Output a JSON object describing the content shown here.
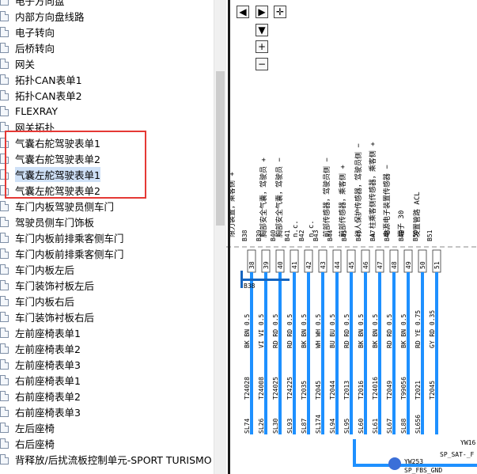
{
  "tree": {
    "items": [
      {
        "label": "电子方向盘"
      },
      {
        "label": "内部方向盘线路"
      },
      {
        "label": "电子转向"
      },
      {
        "label": "后桥转向"
      },
      {
        "label": "网关"
      },
      {
        "label": "拓扑CAN表单1"
      },
      {
        "label": "拓扑CAN表单2"
      },
      {
        "label": "FLEXRAY"
      },
      {
        "label": "网关拓扑"
      },
      {
        "label": "气囊右舵驾驶表单1"
      },
      {
        "label": "气囊右舵驾驶表单2"
      },
      {
        "label": "气囊左舵驾驶表单1",
        "selected": true
      },
      {
        "label": "气囊左舵驾驶表单2"
      },
      {
        "label": "车门内板驾驶员侧车门"
      },
      {
        "label": "驾驶员侧车门饰板"
      },
      {
        "label": "车门内板前排乘客侧车门"
      },
      {
        "label": "车门内板前排乘客侧车门"
      },
      {
        "label": "车门内板左后"
      },
      {
        "label": "车门装饰衬板左后"
      },
      {
        "label": "车门内板右后"
      },
      {
        "label": "车门装饰衬板右后"
      },
      {
        "label": "左前座椅表单1"
      },
      {
        "label": "左前座椅表单2"
      },
      {
        "label": "左前座椅表单3"
      },
      {
        "label": "右前座椅表单1"
      },
      {
        "label": "右前座椅表单2"
      },
      {
        "label": "右前座椅表单3"
      },
      {
        "label": "左后座椅"
      },
      {
        "label": "右后座椅"
      },
      {
        "label": "背释放/后扰流板控制单元-SPORT TURISMO"
      }
    ]
  },
  "toolbar": {
    "left": "◀",
    "right": "▶",
    "center": "✛",
    "up": "▲",
    "down": "▼",
    "zoom_in": "+",
    "zoom_out": "−"
  },
  "diagram": {
    "rotated_labels": [
      "限力装置，乘客侧 +",
      "胸部安全气囊，驾驶员 +",
      "胸部安全气囊，驾驶员 −",
      "n.c.",
      "n.c.",
      "前部传感器，驾驶员侧 −",
      "前部传感器，乘客侧 +",
      "行人保护传感器，驾驶员侧 −",
      "A 柱乘客侧传感器，乘客侧 +",
      "电源电子装置传感器 −",
      "端子 30",
      "发置管路 ACL"
    ],
    "pin_codes": [
      "B38",
      "B39",
      "B40",
      "B41",
      "B42",
      "B43",
      "B44",
      "B45",
      "B46",
      "B47",
      "B48",
      "B49",
      "B50",
      "B51"
    ],
    "pin_numbers": [
      "38",
      "39",
      "40",
      "41",
      "42",
      "43",
      "44",
      "45",
      "46",
      "47",
      "48",
      "49",
      "50",
      "51"
    ],
    "wire_specs": [
      "BK BN 0.5",
      "VI VI 0.5",
      "RD RD 0.5",
      "RD RD 0.5",
      "BK BN 0.5",
      "WH WH 0.5",
      "BU BU 0.5",
      "RD RD 0.5",
      "BK BN 0.5",
      "BK BN 0.5",
      "RD RD 0.5",
      "BK BN 0.5",
      "RD YE 0.75",
      "GY RD 0.35"
    ],
    "connector_codes": [
      "T24028",
      "T24008",
      "T24025",
      "T24225",
      "T2035",
      "T2045",
      "T2044",
      "T2013",
      "T2016",
      "T24016",
      "T2049",
      "T99056",
      "T2021",
      "T2045"
    ],
    "ground_codes": [
      "SL74",
      "SL26",
      "SL30",
      "SL93",
      "SL87",
      "SL174",
      "SL94",
      "SL95",
      "SL60",
      "SL61",
      "SL67",
      "SL88",
      "SL656"
    ],
    "node_label": "YW253",
    "ground_label": "SP_FBS_GND",
    "sat_label": "SP_SAT-_F",
    "corner_label": "YW16"
  },
  "colors": {
    "wire_blue": "#1e90ff",
    "bus_blue": "#1565c0",
    "highlight_red": "#e53935"
  }
}
